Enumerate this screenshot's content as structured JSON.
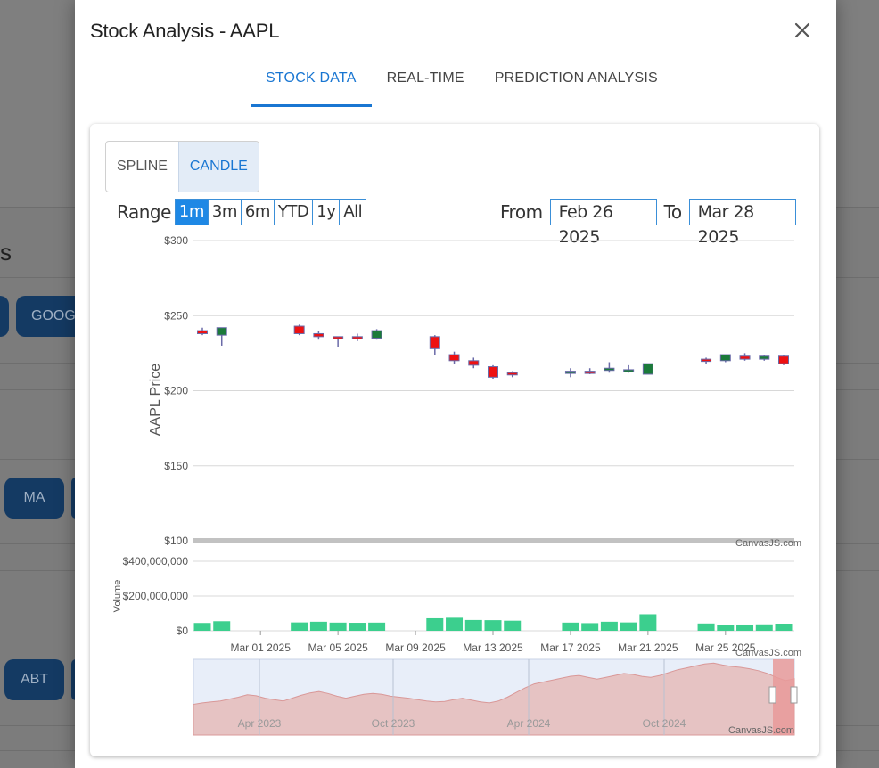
{
  "background": {
    "section_letter": "s",
    "buttons": [
      "",
      "GOOG",
      "MA",
      "ABT"
    ]
  },
  "modal": {
    "title": "Stock Analysis - AAPL",
    "close_icon": "close-icon",
    "tabs": [
      {
        "label": "STOCK DATA",
        "active": true
      },
      {
        "label": "REAL-TIME",
        "active": false
      },
      {
        "label": "PREDICTION ANALYSIS",
        "active": false
      }
    ]
  },
  "controls": {
    "chart_types": [
      {
        "label": "SPLINE",
        "active": false
      },
      {
        "label": "CANDLE",
        "active": true
      }
    ],
    "range_label": "Range",
    "range_buttons": [
      {
        "label": "1m",
        "active": true
      },
      {
        "label": "3m",
        "active": false
      },
      {
        "label": "6m",
        "active": false
      },
      {
        "label": "YTD",
        "active": false
      },
      {
        "label": "1y",
        "active": false
      },
      {
        "label": "All",
        "active": false
      }
    ],
    "from_label": "From",
    "from_value": "Feb 26 2025",
    "to_label": "To",
    "to_value": "Mar 28 2025"
  },
  "chart_data": [
    {
      "type": "candlestick",
      "ylabel": "AAPL Price",
      "ylim": [
        100,
        300
      ],
      "y_ticks": [
        "$300",
        "$250",
        "$200",
        "$150",
        "$100"
      ],
      "watermark": "CanvasJS.com",
      "colors": {
        "up": "#1b7a3a",
        "down": "#ee1111",
        "wick": "#6a6aa8",
        "grid": "#d8d8d8"
      },
      "x_ticks": [
        "Mar 01 2025",
        "Mar 05 2025",
        "Mar 09 2025",
        "Mar 13 2025",
        "Mar 17 2025",
        "Mar 21 2025",
        "Mar 25 2025"
      ],
      "candles": [
        {
          "date": "2025-02-26",
          "o": 240,
          "h": 242,
          "l": 237,
          "c": 238
        },
        {
          "date": "2025-02-27",
          "o": 237,
          "h": 242,
          "l": 230,
          "c": 242
        },
        {
          "date": "2025-03-03",
          "o": 243,
          "h": 244,
          "l": 237,
          "c": 238
        },
        {
          "date": "2025-03-04",
          "o": 238,
          "h": 240,
          "l": 234,
          "c": 236
        },
        {
          "date": "2025-03-05",
          "o": 236,
          "h": 236,
          "l": 229,
          "c": 235
        },
        {
          "date": "2025-03-06",
          "o": 236,
          "h": 238,
          "l": 233,
          "c": 235
        },
        {
          "date": "2025-03-07",
          "o": 235,
          "h": 241,
          "l": 234,
          "c": 240
        },
        {
          "date": "2025-03-10",
          "o": 236,
          "h": 237,
          "l": 224,
          "c": 228
        },
        {
          "date": "2025-03-11",
          "o": 224,
          "h": 226,
          "l": 218,
          "c": 220
        },
        {
          "date": "2025-03-12",
          "o": 220,
          "h": 222,
          "l": 215,
          "c": 217
        },
        {
          "date": "2025-03-13",
          "o": 216,
          "h": 217,
          "l": 208,
          "c": 209
        },
        {
          "date": "2025-03-14",
          "o": 212,
          "h": 213,
          "l": 209,
          "c": 211
        },
        {
          "date": "2025-03-17",
          "o": 213,
          "h": 215,
          "l": 209,
          "c": 213
        },
        {
          "date": "2025-03-18",
          "o": 213,
          "h": 215,
          "l": 211,
          "c": 212
        },
        {
          "date": "2025-03-19",
          "o": 214,
          "h": 219,
          "l": 212,
          "c": 215
        },
        {
          "date": "2025-03-20",
          "o": 214,
          "h": 217,
          "l": 212,
          "c": 214
        },
        {
          "date": "2025-03-21",
          "o": 211,
          "h": 218,
          "l": 211,
          "c": 218
        },
        {
          "date": "2025-03-24",
          "o": 221,
          "h": 222,
          "l": 218,
          "c": 220
        },
        {
          "date": "2025-03-25",
          "o": 220,
          "h": 224,
          "l": 219,
          "c": 224
        },
        {
          "date": "2025-03-26",
          "o": 223,
          "h": 225,
          "l": 220,
          "c": 221
        },
        {
          "date": "2025-03-27",
          "o": 221,
          "h": 224,
          "l": 220,
          "c": 223
        },
        {
          "date": "2025-03-28",
          "o": 223,
          "h": 224,
          "l": 217,
          "c": 218
        }
      ]
    },
    {
      "type": "bar",
      "ylabel": "Volume",
      "ylim": [
        0,
        400000000
      ],
      "y_ticks": [
        "$400,000,000",
        "$200,000,000",
        "$0"
      ],
      "color": "#3ccf8e",
      "values": [
        45000000,
        55000000,
        48000000,
        52000000,
        47000000,
        46000000,
        47000000,
        72000000,
        75000000,
        62000000,
        61000000,
        58000000,
        47000000,
        44000000,
        52000000,
        48000000,
        95000000,
        42000000,
        35000000,
        36000000,
        37000000,
        41000000
      ]
    },
    {
      "type": "area",
      "role": "navigator",
      "x_ticks": [
        "Apr 2023",
        "Oct 2023",
        "Apr 2024",
        "Oct 2024"
      ],
      "values": [
        165,
        168,
        170,
        172,
        176,
        180,
        185,
        183,
        178,
        175,
        172,
        178,
        184,
        189,
        192,
        188,
        182,
        178,
        182,
        186,
        188,
        186,
        182,
        180,
        178,
        175,
        172,
        170,
        171,
        175,
        178,
        174,
        170,
        168,
        172,
        180,
        190,
        200,
        208,
        212,
        216,
        220,
        224,
        226,
        222,
        218,
        222,
        226,
        230,
        228,
        224,
        222,
        226,
        232,
        238,
        242,
        246,
        250,
        252,
        248,
        245,
        243,
        240,
        236,
        230,
        222,
        215,
        219
      ],
      "ylim": [
        100,
        260
      ],
      "selection": "Feb 26 2025 - Mar 28 2025",
      "colors": {
        "fill": "#e6c3c3",
        "stroke": "#d99898",
        "background": "#e8eef9",
        "selection": "#e89a9a"
      },
      "watermarks": [
        "CanvasJS.com",
        "CanvasJS.com"
      ]
    }
  ]
}
